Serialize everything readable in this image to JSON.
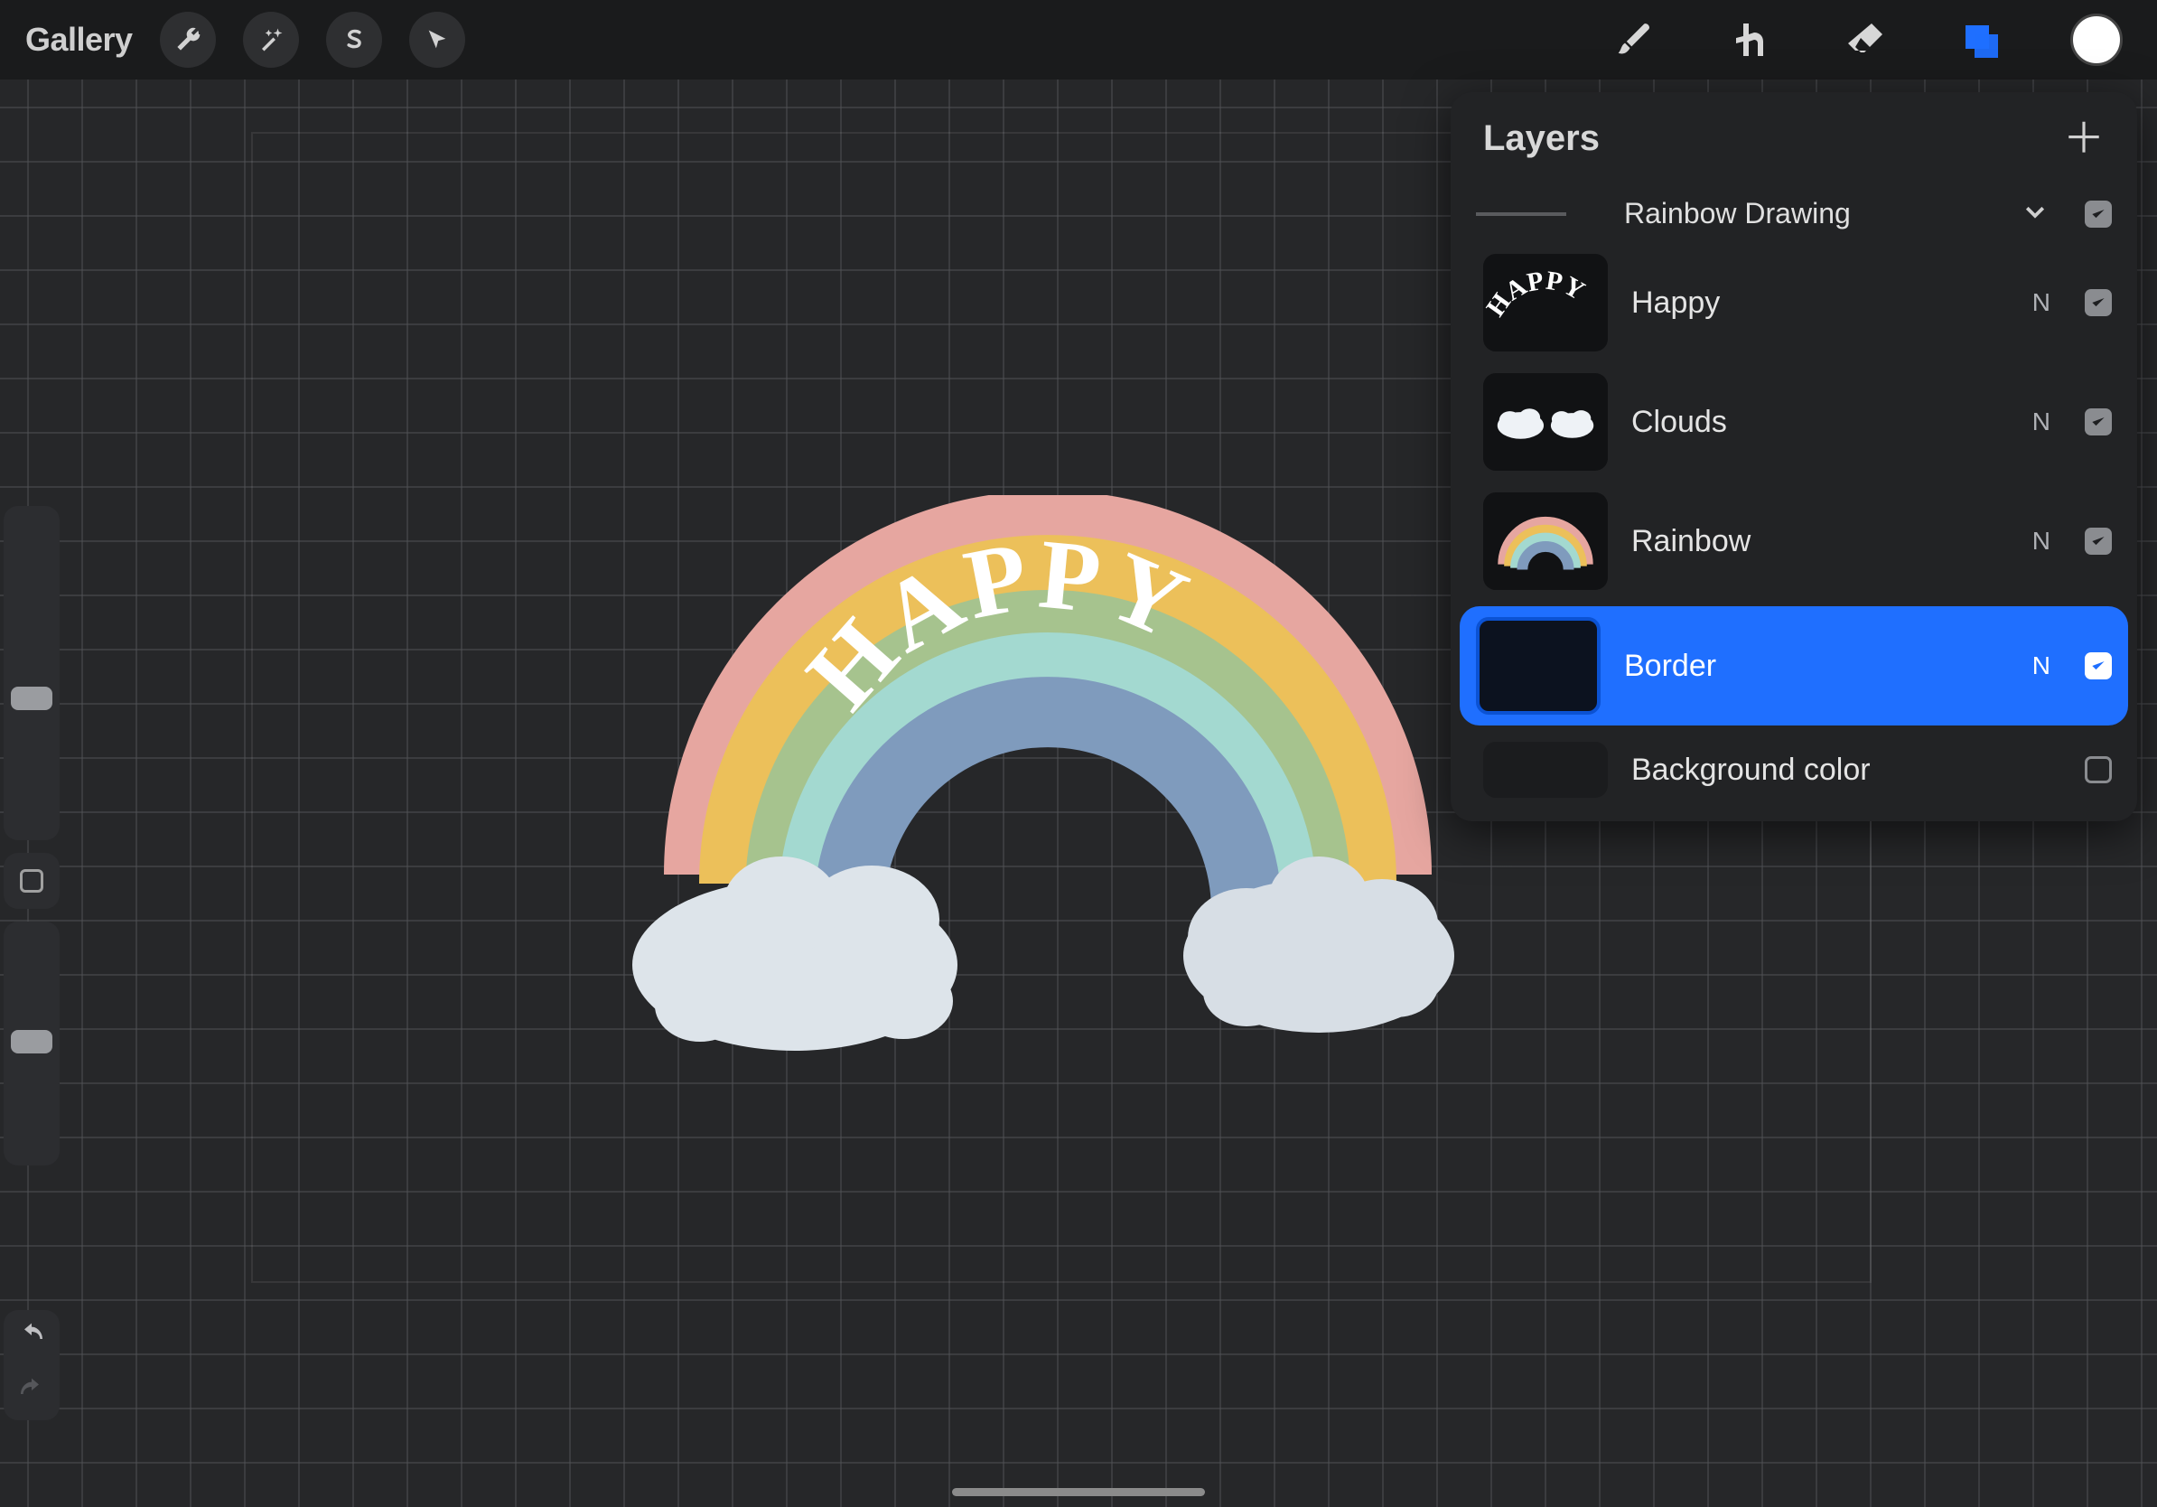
{
  "topbar": {
    "gallery_label": "Gallery"
  },
  "artwork_text": "HAPPY",
  "colors": {
    "accent": "#1f6fff",
    "rainbow_pink": "#e6a6a0",
    "rainbow_yellow": "#ecc05a",
    "rainbow_green": "#a6c38e",
    "rainbow_teal": "#a3d9d0",
    "rainbow_blue": "#7f9bbd",
    "cloud": "#dde4ea",
    "swatch": "#ffffff"
  },
  "layers_panel": {
    "title": "Layers",
    "group_name": "Rainbow Drawing",
    "layers": [
      {
        "name": "Happy",
        "blend": "N",
        "visible": true,
        "selected": false,
        "thumb": "happy"
      },
      {
        "name": "Clouds",
        "blend": "N",
        "visible": true,
        "selected": false,
        "thumb": "clouds"
      },
      {
        "name": "Rainbow",
        "blend": "N",
        "visible": true,
        "selected": false,
        "thumb": "rainbow"
      },
      {
        "name": "Border",
        "blend": "N",
        "visible": true,
        "selected": true,
        "thumb": "blank"
      }
    ],
    "background_label": "Background color",
    "background_visible": false
  }
}
